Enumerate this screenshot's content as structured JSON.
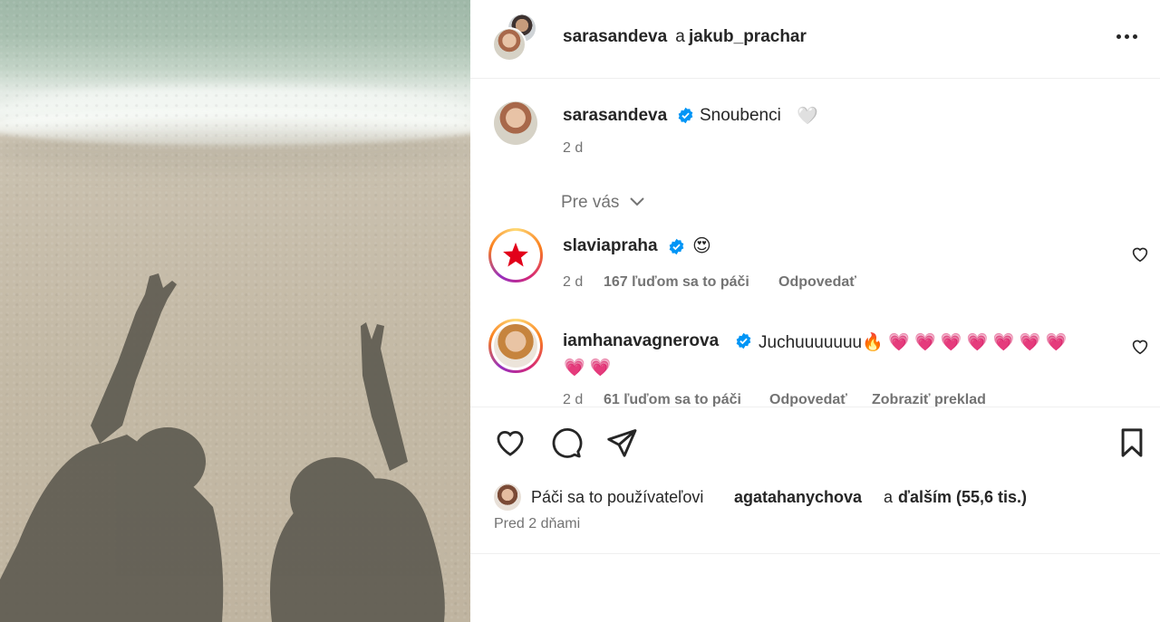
{
  "header": {
    "title_user1": "sarasandeva",
    "title_sep": " a ",
    "title_user2": "jakub_prachar",
    "more_icon": "more-horizontal-icon"
  },
  "caption": {
    "username": "sarasandeva",
    "text": "Snoubenci",
    "emoji": "🤍",
    "time": "2 d"
  },
  "comments_filter": {
    "label": "Pre vás",
    "icon": "chevron-down-icon"
  },
  "comments": [
    {
      "username": "slaviapraha",
      "text": "😍",
      "time": "2 d",
      "likes": "167 ľuďom sa to páči",
      "reply": "Odpovedať"
    },
    {
      "username": "iamhanavagnerova",
      "text_line1": "Juchuuuuuuu🔥 💗 💗 💗 💗 💗 💗 💗",
      "text_line2": "💗 💗",
      "time": "2 d",
      "likes": "61 ľuďom sa to páči",
      "reply": "Odpovedať",
      "translate": "Zobraziť preklad"
    }
  ],
  "actions": {
    "like_icon": "heart-icon",
    "comment_icon": "comment-icon",
    "share_icon": "send-icon",
    "save_icon": "bookmark-icon"
  },
  "likes": {
    "prefix": "Páči sa to používateľovi",
    "user": "agatahanychova",
    "mid": "a",
    "others": "ďalším (55,6 tis.)"
  },
  "posted": "Pred 2 dňami",
  "colors": {
    "verified": "#0095f6",
    "slavia_red": "#e2001a",
    "text": "#262626",
    "secondary": "#737373"
  }
}
